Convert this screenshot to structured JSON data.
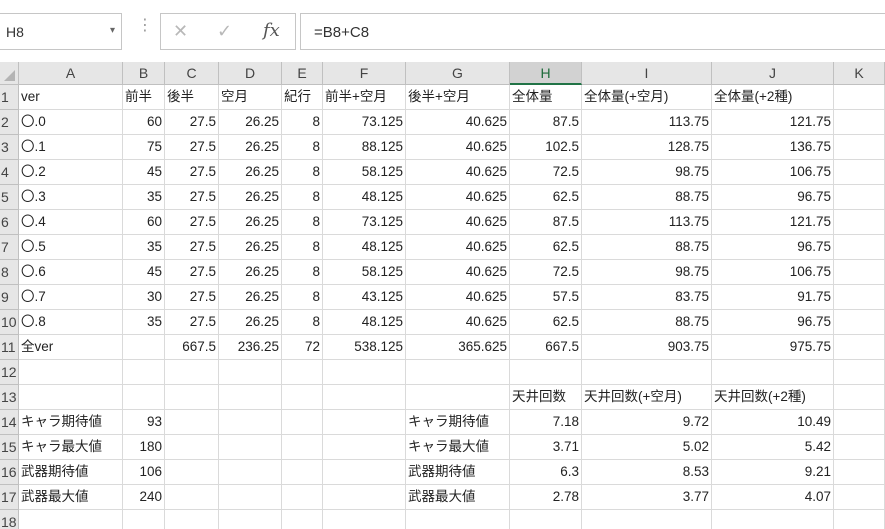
{
  "formula_bar": {
    "name_box": "H8",
    "name_box_arrow": "▾",
    "dots": "⋮",
    "cancel": "✕",
    "enter": "✓",
    "fx": "fx",
    "formula": "=B8+C8"
  },
  "columns": [
    "A",
    "B",
    "C",
    "D",
    "E",
    "F",
    "G",
    "H",
    "I",
    "J",
    "K"
  ],
  "selected_column": "H",
  "selected_row": 8,
  "rows": [
    {
      "n": "1",
      "cells": {
        "A": "ver",
        "B": "前半",
        "C": "後半",
        "D": "空月",
        "E": "紀行",
        "F": "前半+空月",
        "G": "後半+空月",
        "H": "全体量",
        "I": "全体量(+空月)",
        "J": "全体量(+2種)"
      }
    },
    {
      "n": "2",
      "cells": {
        "A": "〇.0",
        "B": "60",
        "C": "27.5",
        "D": "26.25",
        "E": "8",
        "F": "73.125",
        "G": "40.625",
        "H": "87.5",
        "I": "113.75",
        "J": "121.75"
      }
    },
    {
      "n": "3",
      "cells": {
        "A": "〇.1",
        "B": "75",
        "C": "27.5",
        "D": "26.25",
        "E": "8",
        "F": "88.125",
        "G": "40.625",
        "H": "102.5",
        "I": "128.75",
        "J": "136.75"
      }
    },
    {
      "n": "4",
      "cells": {
        "A": "〇.2",
        "B": "45",
        "C": "27.5",
        "D": "26.25",
        "E": "8",
        "F": "58.125",
        "G": "40.625",
        "H": "72.5",
        "I": "98.75",
        "J": "106.75"
      }
    },
    {
      "n": "5",
      "cells": {
        "A": "〇.3",
        "B": "35",
        "C": "27.5",
        "D": "26.25",
        "E": "8",
        "F": "48.125",
        "G": "40.625",
        "H": "62.5",
        "I": "88.75",
        "J": "96.75"
      }
    },
    {
      "n": "6",
      "cells": {
        "A": "〇.4",
        "B": "60",
        "C": "27.5",
        "D": "26.25",
        "E": "8",
        "F": "73.125",
        "G": "40.625",
        "H": "87.5",
        "I": "113.75",
        "J": "121.75"
      }
    },
    {
      "n": "7",
      "cells": {
        "A": "〇.5",
        "B": "35",
        "C": "27.5",
        "D": "26.25",
        "E": "8",
        "F": "48.125",
        "G": "40.625",
        "H": "62.5",
        "I": "88.75",
        "J": "96.75"
      }
    },
    {
      "n": "8",
      "cells": {
        "A": "〇.6",
        "B": "45",
        "C": "27.5",
        "D": "26.25",
        "E": "8",
        "F": "58.125",
        "G": "40.625",
        "H": "72.5",
        "I": "98.75",
        "J": "106.75"
      }
    },
    {
      "n": "9",
      "cells": {
        "A": "〇.7",
        "B": "30",
        "C": "27.5",
        "D": "26.25",
        "E": "8",
        "F": "43.125",
        "G": "40.625",
        "H": "57.5",
        "I": "83.75",
        "J": "91.75"
      }
    },
    {
      "n": "10",
      "cells": {
        "A": "〇.8",
        "B": "35",
        "C": "27.5",
        "D": "26.25",
        "E": "8",
        "F": "48.125",
        "G": "40.625",
        "H": "62.5",
        "I": "88.75",
        "J": "96.75"
      }
    },
    {
      "n": "11",
      "cells": {
        "A": "全ver",
        "C": "667.5",
        "D": "236.25",
        "E": "72",
        "F": "538.125",
        "G": "365.625",
        "H": "667.5",
        "I": "903.75",
        "J": "975.75"
      }
    },
    {
      "n": "12",
      "cells": {}
    },
    {
      "n": "13",
      "cells": {
        "H": "天井回数",
        "I": "天井回数(+空月)",
        "J": "天井回数(+2種)"
      }
    },
    {
      "n": "14",
      "cells": {
        "A": "キャラ期待値",
        "B": "93",
        "G": "キャラ期待値",
        "H": "7.18",
        "I": "9.72",
        "J": "10.49"
      }
    },
    {
      "n": "15",
      "cells": {
        "A": "キャラ最大値",
        "B": "180",
        "G": "キャラ最大値",
        "H": "3.71",
        "I": "5.02",
        "J": "5.42"
      }
    },
    {
      "n": "16",
      "cells": {
        "A": "武器期待値",
        "B": "106",
        "G": "武器期待値",
        "H": "6.3",
        "I": "8.53",
        "J": "9.21"
      }
    },
    {
      "n": "17",
      "cells": {
        "A": "武器最大値",
        "B": "240",
        "G": "武器最大値",
        "H": "2.78",
        "I": "3.77",
        "J": "4.07"
      }
    },
    {
      "n": "18",
      "cells": {}
    }
  ]
}
